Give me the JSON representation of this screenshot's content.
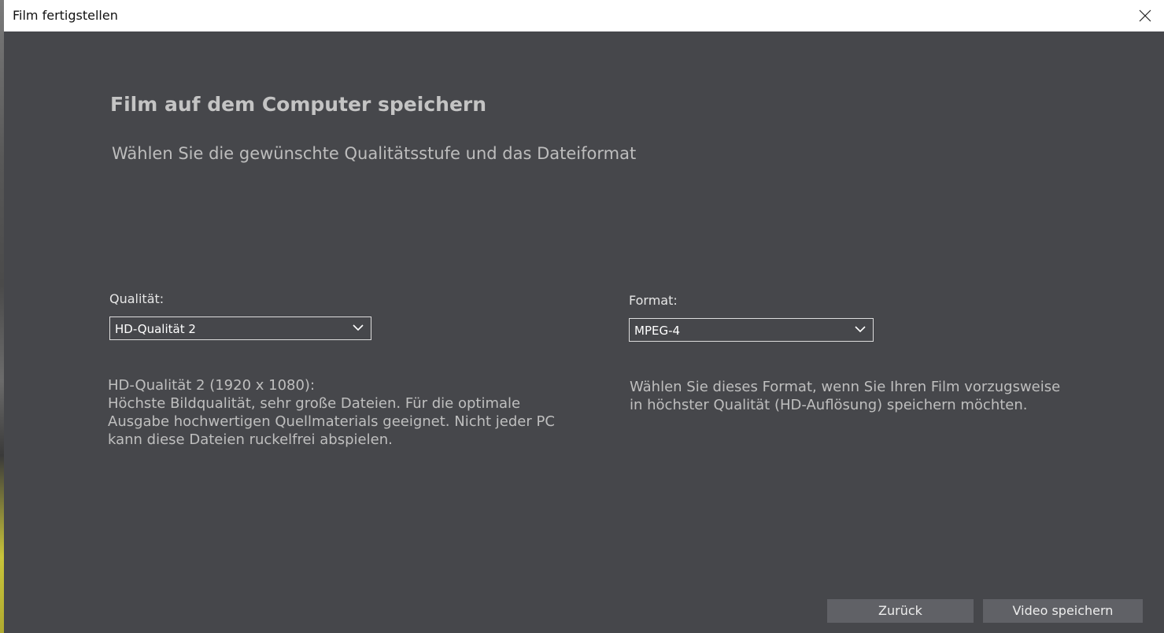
{
  "window": {
    "title": "Film fertigstellen",
    "close_icon": "close-icon"
  },
  "page": {
    "heading": "Film auf dem Computer speichern",
    "subheading": "Wählen Sie die gewünschte Qualitätsstufe und das Dateiformat"
  },
  "quality": {
    "label": "Qualität:",
    "selected": "HD-Qualität 2",
    "description_lines": [
      "HD-Qualität 2 (1920 x 1080):",
      "Höchste Bildqualität, sehr große Dateien. Für die optimale",
      "Ausgabe hochwertigen Quellmaterials geeignet. Nicht jeder PC",
      "kann diese Dateien ruckelfrei abspielen."
    ]
  },
  "format": {
    "label": "Format:",
    "selected": "MPEG-4",
    "description_lines": [
      "Wählen Sie dieses Format, wenn Sie Ihren Film vorzugsweise",
      "in höchster Qualität (HD-Auflösung) speichern möchten."
    ]
  },
  "buttons": {
    "back": "Zurück",
    "save": "Video speichern"
  },
  "colors": {
    "background": "#46474b",
    "titlebar": "#ffffff",
    "button": "#606166",
    "heading_text": "#c4c4c4"
  }
}
